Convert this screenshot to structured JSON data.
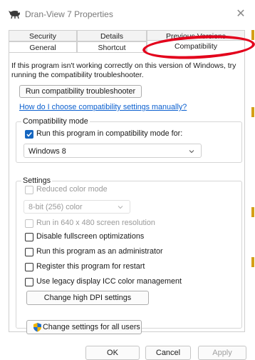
{
  "window": {
    "title": "Dran-View 7 Properties",
    "close_glyph": "✕",
    "icon": "app-icon"
  },
  "tabs": {
    "row1": [
      "Security",
      "Details",
      "Previous Versions"
    ],
    "row2": [
      "General",
      "Shortcut",
      "Compatibility"
    ],
    "active": "Compatibility"
  },
  "intro_text": "If this program isn't working correctly on this version of Windows, try running the compatibility troubleshooter.",
  "troubleshooter_button": "Run compatibility troubleshooter",
  "manual_link": "How do I choose compatibility settings manually?",
  "compat_mode": {
    "legend": "Compatibility mode",
    "checkbox_label": "Run this program in compatibility mode for:",
    "checked": true,
    "selected_os": "Windows 8"
  },
  "settings": {
    "legend": "Settings",
    "reduced_color": {
      "label": "Reduced color mode",
      "checked": false,
      "enabled": false
    },
    "color_select": "8-bit (256) color",
    "resolution_640": {
      "label": "Run in 640 x 480 screen resolution",
      "checked": false,
      "enabled": false
    },
    "disable_fullscreen": {
      "label": "Disable fullscreen optimizations",
      "checked": false
    },
    "run_as_admin": {
      "label": "Run this program as an administrator",
      "checked": false
    },
    "register_restart": {
      "label": "Register this program for restart",
      "checked": false
    },
    "legacy_icc": {
      "label": "Use legacy display ICC color management",
      "checked": false
    },
    "high_dpi_button": "Change high DPI settings"
  },
  "all_users_button": "Change settings for all users",
  "footer": {
    "ok": "OK",
    "cancel": "Cancel",
    "apply": "Apply"
  },
  "colors": {
    "accent": "#1566c0",
    "link": "#0a5fcf",
    "annotation": "#e3001b"
  }
}
